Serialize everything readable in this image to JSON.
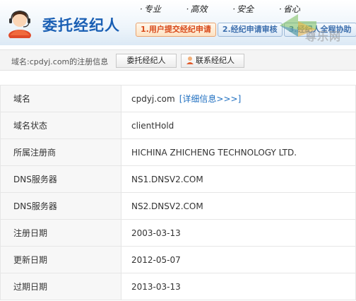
{
  "banner": {
    "title": "委托经纪人",
    "slogans": [
      "专业",
      "高效",
      "安全",
      "省心"
    ],
    "steps": [
      "1.用户提交经纪申请",
      "2.经纪申请审核",
      "3.经纪人全程协助"
    ],
    "watermark": "尊乐网",
    "colors": {
      "title": "#1a5fb4",
      "step_active": "#d84a1b",
      "step_inactive": "#3d6fae"
    }
  },
  "infobar": {
    "label": "域名:cpdyj.com的注册信息",
    "tab1": "委托经纪人",
    "tab2": "联系经纪人"
  },
  "rows": [
    {
      "key": "域名",
      "value": "cpdyj.com",
      "link": "[详细信息>>>]"
    },
    {
      "key": "域名状态",
      "value": "clientHold"
    },
    {
      "key": "所属注册商",
      "value": "HICHINA ZHICHENG TECHNOLOGY LTD."
    },
    {
      "key": "DNS服务器",
      "value": "NS1.DNSV2.COM"
    },
    {
      "key": "DNS服务器",
      "value": "NS2.DNSV2.COM"
    },
    {
      "key": "注册日期",
      "value": "2003-03-13"
    },
    {
      "key": "更新日期",
      "value": "2012-05-07"
    },
    {
      "key": "过期日期",
      "value": "2013-03-13"
    }
  ]
}
